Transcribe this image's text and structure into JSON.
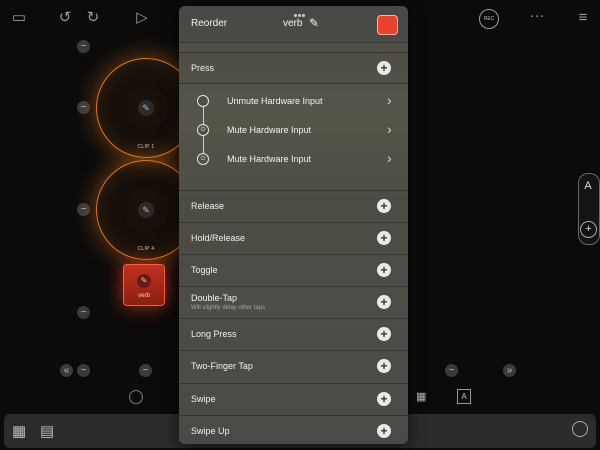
{
  "toolbar": {
    "icons": [
      "folder-icon",
      "undo-icon",
      "redo-icon",
      "play-icon",
      "record-icon",
      "more-icon",
      "menu-icon"
    ],
    "rec_label": "REC",
    "more_label": "···"
  },
  "clips": [
    {
      "label": "CLIP 1"
    },
    {
      "label": "CLIP 4"
    }
  ],
  "verb_pad": {
    "label": "verb"
  },
  "right_controls": {
    "letter_label": "A"
  },
  "panel": {
    "header": {
      "reorder_label": "Reorder",
      "name": "verb",
      "color": "#e8432f"
    },
    "press": {
      "label": "Press",
      "actions": [
        {
          "label": "Unmute Hardware Input"
        },
        {
          "label": "Mute Hardware Input"
        },
        {
          "label": "Mute Hardware Input"
        }
      ]
    },
    "gestures": [
      {
        "label": "Release",
        "sub": ""
      },
      {
        "label": "Hold/Release",
        "sub": ""
      },
      {
        "label": "Toggle",
        "sub": ""
      },
      {
        "label": "Double-Tap",
        "sub": "Will slightly delay other taps"
      },
      {
        "label": "Long Press",
        "sub": ""
      },
      {
        "label": "Two-Finger Tap",
        "sub": ""
      },
      {
        "label": "Swipe",
        "sub": ""
      },
      {
        "label": "Swipe Up",
        "sub": ""
      }
    ]
  },
  "bottom_bar": {
    "icons": [
      "grid-icon",
      "list-icon",
      "palette-icon"
    ]
  },
  "colors": {
    "accent_orange": "#e0761f",
    "verb_red": "#c0321f",
    "panel_bg": "#4f4f49"
  }
}
